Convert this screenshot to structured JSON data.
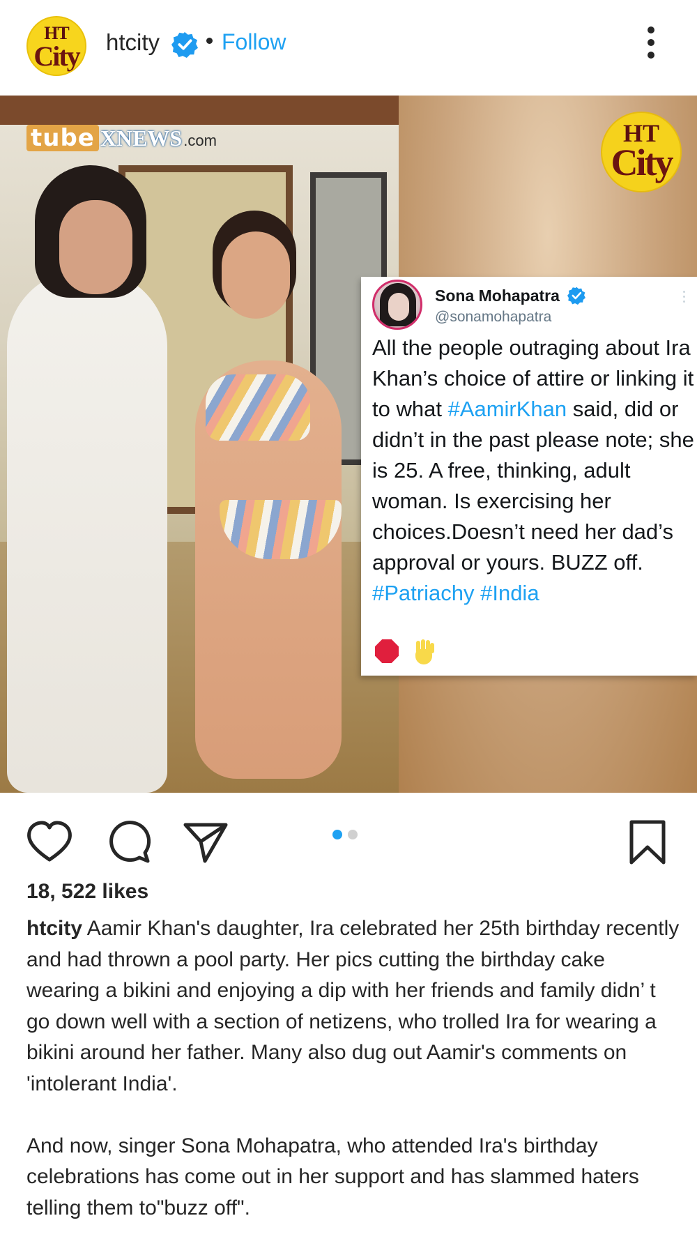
{
  "header": {
    "avatar_top": "HT",
    "avatar_bottom": "City",
    "username": "htcity",
    "follow_label": "Follow"
  },
  "post_image": {
    "watermark_tube": "tube",
    "watermark_xnews": "XNEWS",
    "watermark_com": ".com",
    "badge_top": "HT",
    "badge_bottom": "City"
  },
  "tweet": {
    "name": "Sona Mohapatra",
    "handle": "@sonamohapatra",
    "text_part1": "All the people outraging about Ira Khan’s choice of attire or linking it to what ",
    "tag1": "#AamirKhan",
    "text_part2": " said, did or didn’t in the past please note; she is 25. A free, thinking, adult woman. Is exercising her choices.Doesn’t need her dad’s approval or yours. BUZZ off. ",
    "tag2": "#Patriachy",
    "tag3": "#India",
    "emojis": [
      "stop-sign-icon",
      "raised-hand-icon"
    ]
  },
  "carousel": {
    "total": 2,
    "current": 1
  },
  "likes": "18, 522 likes",
  "caption": {
    "username": "htcity",
    "paragraph1": " Aamir Khan's daughter,  Ira celebrated her 25th birthday recently and had thrown a pool party.  Her pics cutting the birthday cake wearing a bikini and enjoying a dip with her friends and family didn’ t go down well with a section of netizens,  who trolled Ira for wearing a bikini around her father.  Many also dug out Aamir's comments on 'intolerant India'.",
    "paragraph2": "And now,  singer Sona Mohapatra,  who attended Ira's birthday celebrations has come out in her support and has slammed haters telling them to\"buzz off\"."
  },
  "colors": {
    "accent": "#1ea1f2",
    "text": "#262626",
    "brand_yellow": "#f5d21c"
  }
}
